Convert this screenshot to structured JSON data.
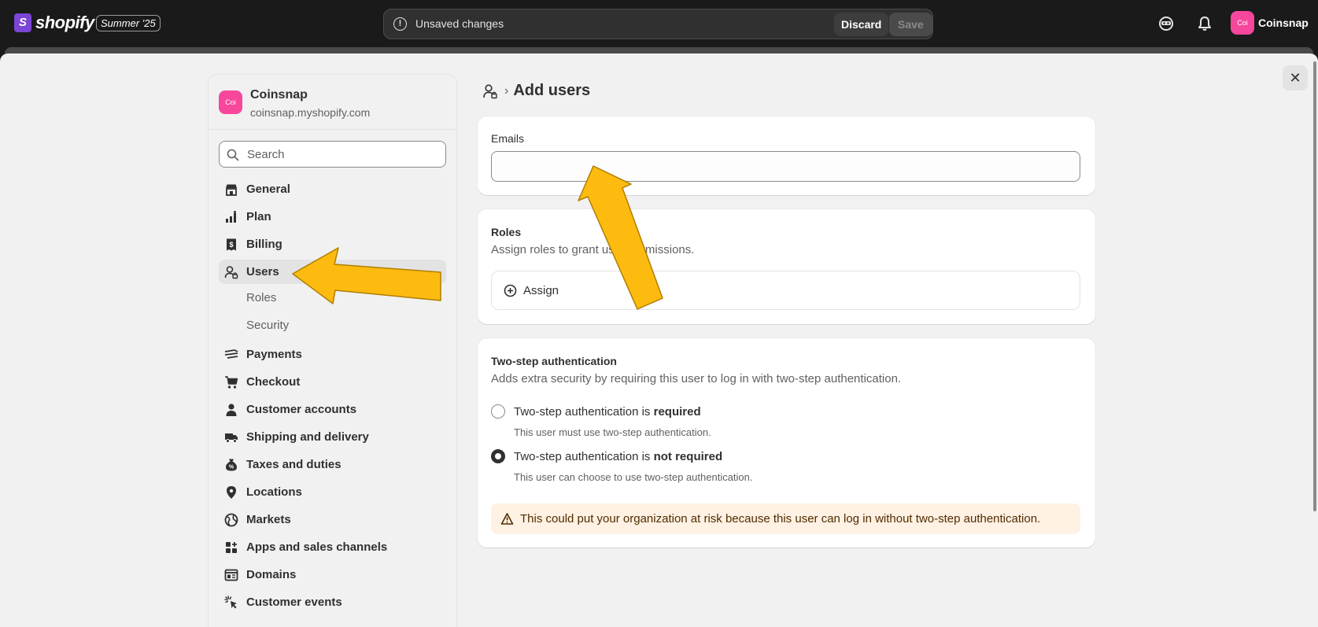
{
  "topbar": {
    "brand": "shopify",
    "edition": "Summer '25",
    "unsaved_text": "Unsaved changes",
    "discard_label": "Discard",
    "save_label": "Save",
    "user_initials": "Coi",
    "user_name": "Coinsnap"
  },
  "store": {
    "initials": "Coi",
    "name": "Coinsnap",
    "domain": "coinsnap.myshopify.com"
  },
  "search": {
    "placeholder": "Search"
  },
  "sidebar": {
    "items": [
      {
        "label": "General",
        "icon": "store-icon"
      },
      {
        "label": "Plan",
        "icon": "plan-icon"
      },
      {
        "label": "Billing",
        "icon": "billing-icon"
      },
      {
        "label": "Users",
        "icon": "users-icon",
        "active": true
      },
      {
        "label": "Payments",
        "icon": "payments-icon"
      },
      {
        "label": "Checkout",
        "icon": "cart-icon"
      },
      {
        "label": "Customer accounts",
        "icon": "person-icon"
      },
      {
        "label": "Shipping and delivery",
        "icon": "truck-icon"
      },
      {
        "label": "Taxes and duties",
        "icon": "tax-icon"
      },
      {
        "label": "Locations",
        "icon": "location-icon"
      },
      {
        "label": "Markets",
        "icon": "globe-icon"
      },
      {
        "label": "Apps and sales channels",
        "icon": "apps-icon"
      },
      {
        "label": "Domains",
        "icon": "domains-icon"
      },
      {
        "label": "Customer events",
        "icon": "cursor-icon"
      }
    ],
    "subitems": [
      "Roles",
      "Security"
    ]
  },
  "main": {
    "title": "Add users",
    "emails_label": "Emails",
    "roles_title": "Roles",
    "roles_sub": "Assign roles to grant user permissions.",
    "assign_label": "Assign",
    "twostep_title": "Two-step authentication",
    "twostep_sub": "Adds extra security by requiring this user to log in with two-step authentication.",
    "opt_required_prefix": "Two-step authentication is ",
    "opt_required_bold": "required",
    "opt_required_help": "This user must use two-step authentication.",
    "opt_notrequired_prefix": "Two-step authentication is ",
    "opt_notrequired_bold": "not required",
    "opt_notrequired_help": "This user can choose to use two-step authentication.",
    "selected_option": "not required",
    "warning": "This could put your organization at risk because this user can log in without two-step authentication."
  },
  "colors": {
    "accent_pink": "#f6479c",
    "annotation_arrow": "#fdbb10",
    "warning_bg": "#fff1e3"
  }
}
